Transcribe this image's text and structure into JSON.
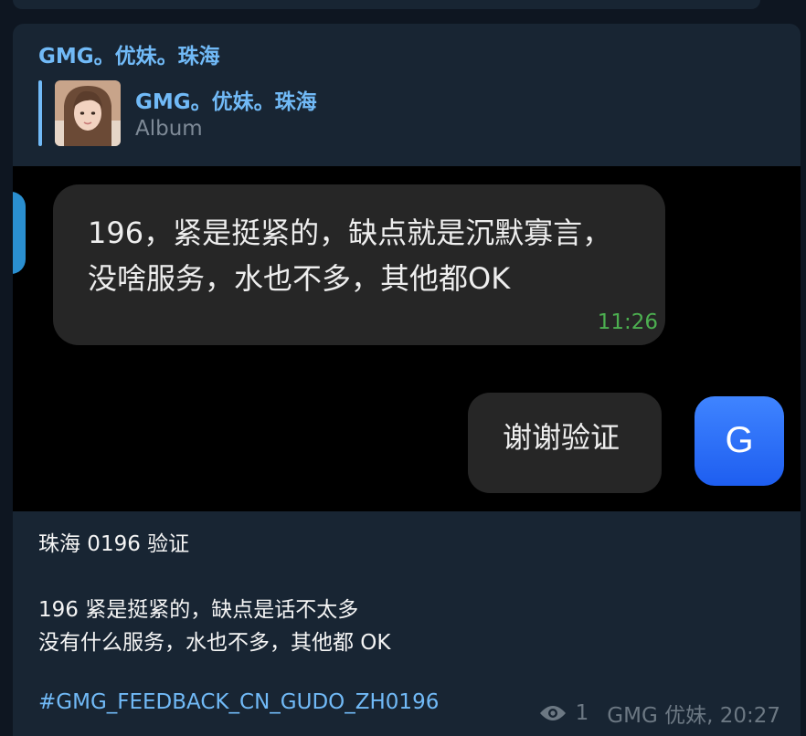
{
  "message": {
    "sender": "GMG。优妹。珠海",
    "reply": {
      "title": "GMG。优妹。珠海",
      "subtitle": "Album"
    },
    "photo": {
      "incoming_line1": "196，紧是挺紧的，缺点就是沉默寡言，",
      "incoming_line2": "没啥服务，水也不多，其他都OK",
      "incoming_time": "11:26",
      "outgoing_text": "谢谢验证",
      "avatar_letter": "G"
    },
    "caption": {
      "line1": "珠海 0196 验证",
      "line2": "196 紧是挺紧的，缺点是话不太多",
      "line3": "没有什么服务，水也不多，其他都 OK"
    },
    "hashtag": "#GMG_FEEDBACK_CN_GUDO_ZH0196",
    "meta": {
      "views": "1",
      "author_time": "GMG 优妹, 20:27"
    }
  },
  "colors": {
    "background": "#0e1621",
    "bubble": "#182533",
    "accent": "#71baf7",
    "meta_text": "#6c7883",
    "chat_time_green": "#4caf50",
    "avatar_blue": "#2f6ff9"
  },
  "icons": {
    "views": "eye-icon"
  }
}
